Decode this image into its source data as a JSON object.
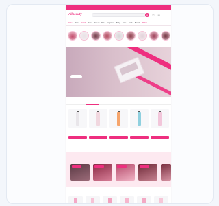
{
  "colors": {
    "accent": "#ee2f7f",
    "banner_bg": "#d9bfcb",
    "deals_bg": "#fde9f0"
  },
  "promo_bar": {
    "text": ""
  },
  "header": {
    "logo": "Allbeauty",
    "search_placeholder": "",
    "icons": [
      "user-icon",
      "heart-icon",
      "cart-icon"
    ]
  },
  "nav": {
    "items": [
      "Home",
      "New",
      "Trends",
      "Face",
      "Makeup",
      "Hair",
      "Fragrance",
      "Body",
      "Nails",
      "Tools",
      "Brands",
      "Offers"
    ]
  },
  "categories": [
    {
      "label": ""
    },
    {
      "label": ""
    },
    {
      "label": ""
    },
    {
      "label": ""
    },
    {
      "label": ""
    },
    {
      "label": ""
    },
    {
      "label": ""
    },
    {
      "label": ""
    },
    {
      "label": ""
    }
  ],
  "banner": {
    "subtitle": "",
    "title": "",
    "button": ""
  },
  "tabs": [
    "",
    "",
    ""
  ],
  "products": [
    {
      "name": "",
      "price": "",
      "color": "#e9e6ea"
    },
    {
      "name": "",
      "price": "",
      "color": "#f1d7df"
    },
    {
      "name": "",
      "price": "",
      "color": "#f6a56c"
    },
    {
      "name": "",
      "price": "",
      "color": "#8fd0df"
    },
    {
      "name": "",
      "price": "",
      "color": "#f2c6da"
    }
  ],
  "see_all": "",
  "deals": {
    "title": "",
    "items": [
      {
        "caption": "",
        "color": "#7b4a58"
      },
      {
        "caption": "",
        "color": "#a43a56"
      },
      {
        "caption": "",
        "color": "#c7607f"
      },
      {
        "caption": "",
        "color": "#8e3b4c"
      }
    ]
  },
  "best_sellers": {
    "title": ""
  }
}
